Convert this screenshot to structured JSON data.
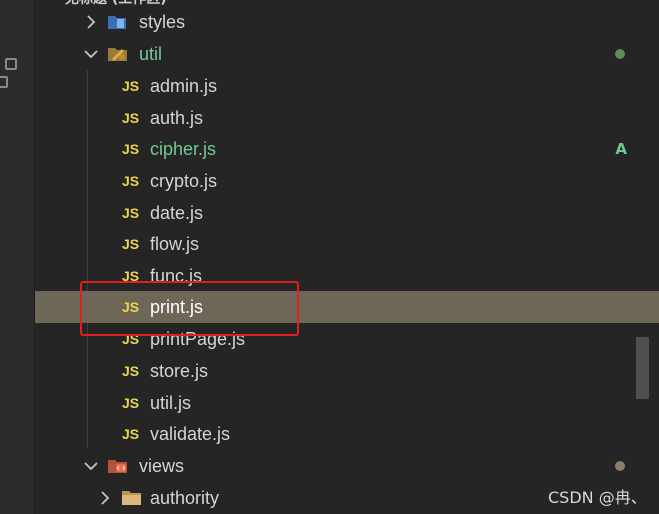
{
  "header": {
    "title": "无标题 (工作区)"
  },
  "colors": {
    "selection": "#6e6757",
    "modified_green": "#73c991",
    "js_yellow": "#e8d44d",
    "highlight_red": "#e0201c",
    "dot_util": "#5b8c5a",
    "dot_views": "#8a7f64"
  },
  "tree": {
    "styles": {
      "label": "styles",
      "icon": "styles-folder-icon"
    },
    "util": {
      "label": "util",
      "icon": "util-folder-icon"
    },
    "files": [
      {
        "label": "admin.js",
        "icon": "JS"
      },
      {
        "label": "auth.js",
        "icon": "JS"
      },
      {
        "label": "cipher.js",
        "icon": "JS",
        "badge": "A"
      },
      {
        "label": "crypto.js",
        "icon": "JS"
      },
      {
        "label": "date.js",
        "icon": "JS"
      },
      {
        "label": "flow.js",
        "icon": "JS"
      },
      {
        "label": "func.js",
        "icon": "JS"
      },
      {
        "label": "print.js",
        "icon": "JS"
      },
      {
        "label": "printPage.js",
        "icon": "JS"
      },
      {
        "label": "store.js",
        "icon": "JS"
      },
      {
        "label": "util.js",
        "icon": "JS"
      },
      {
        "label": "validate.js",
        "icon": "JS"
      }
    ],
    "views": {
      "label": "views",
      "icon": "views-folder-icon"
    },
    "authority": {
      "label": "authority",
      "icon": "folder-icon"
    }
  },
  "watermark": "CSDN @冉、"
}
